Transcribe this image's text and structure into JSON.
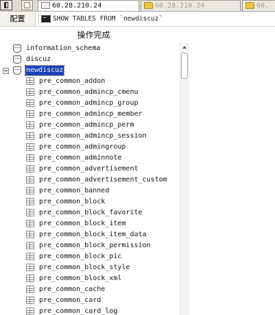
{
  "tabs": [
    {
      "label": "60.28.210.24",
      "icon": "console-icon",
      "active": true
    },
    {
      "label": "60.28.210.24",
      "icon": "folder-icon",
      "active": false
    },
    {
      "label": "60.",
      "icon": "folder-icon",
      "active": false
    }
  ],
  "toolbar": {
    "config_label": "配置"
  },
  "query": {
    "text": "SHOW TABLES FROM `newdiscuz`"
  },
  "status": {
    "text": "操作完成"
  },
  "tree": {
    "databases": [
      {
        "name": "information_schema"
      },
      {
        "name": "discuz"
      },
      {
        "name": "newdiscuz",
        "expanded": true,
        "selected": true
      }
    ],
    "tables": [
      "pre_common_addon",
      "pre_common_admincp_cmenu",
      "pre_common_admincp_group",
      "pre_common_admincp_member",
      "pre_common_admincp_perm",
      "pre_common_admincp_session",
      "pre_common_admingroup",
      "pre_common_adminnote",
      "pre_common_advertisement",
      "pre_common_advertisement_custom",
      "pre_common_banned",
      "pre_common_block",
      "pre_common_block_favorite",
      "pre_common_block_item",
      "pre_common_block_item_data",
      "pre_common_block_permission",
      "pre_common_block_pic",
      "pre_common_block_style",
      "pre_common_block_xml",
      "pre_common_cache",
      "pre_common_card",
      "pre_common_card_log"
    ]
  },
  "colors": {
    "selection": "#1d3fb5",
    "folder": "#e9c645"
  }
}
